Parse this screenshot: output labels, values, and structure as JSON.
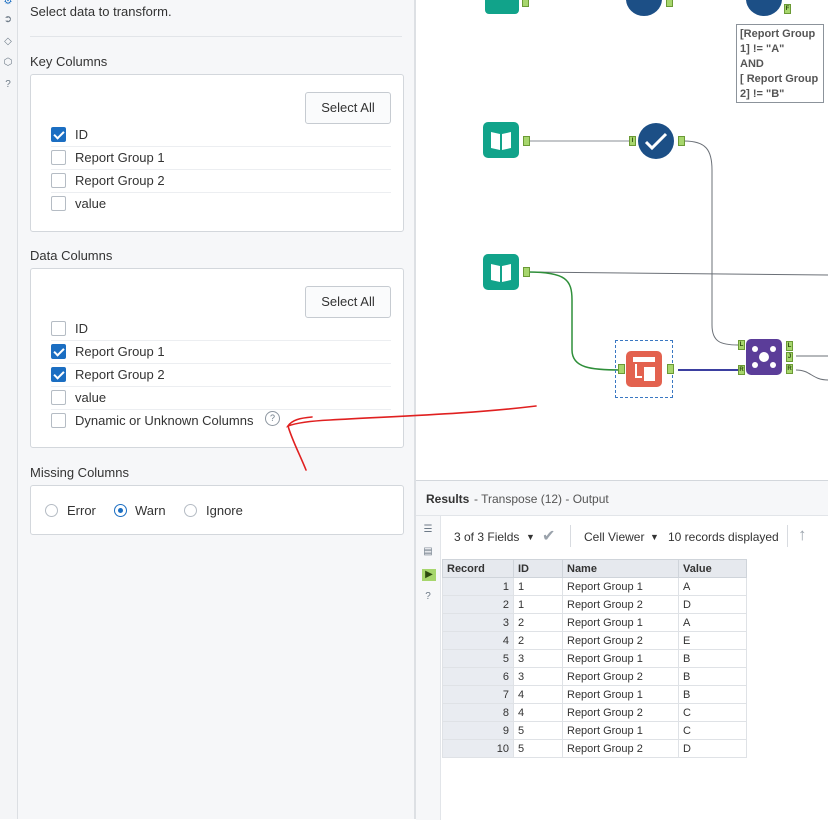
{
  "config": {
    "intro": "Select data to transform.",
    "key_columns": {
      "title": "Key Columns",
      "select_all": "Select All",
      "items": [
        {
          "label": "ID",
          "checked": true
        },
        {
          "label": "Report Group 1",
          "checked": false
        },
        {
          "label": "Report Group 2",
          "checked": false
        },
        {
          "label": "value",
          "checked": false
        }
      ]
    },
    "data_columns": {
      "title": "Data Columns",
      "select_all": "Select All",
      "items": [
        {
          "label": "ID",
          "checked": false
        },
        {
          "label": "Report Group 1",
          "checked": true
        },
        {
          "label": "Report Group 2",
          "checked": true
        },
        {
          "label": "value",
          "checked": false
        },
        {
          "label": "Dynamic or Unknown Columns",
          "checked": false
        }
      ]
    },
    "missing_columns": {
      "title": "Missing Columns",
      "options": [
        "Error",
        "Warn",
        "Ignore"
      ],
      "selected": "Warn"
    }
  },
  "canvas": {
    "filter_note": [
      "[Report Group",
      "1] != \"A\"",
      "AND",
      "[ Report Group",
      "2] != \"B\""
    ],
    "anchors": {
      "left": "L",
      "join": "J",
      "right": "R",
      "input": "I",
      "false": "F"
    }
  },
  "results": {
    "title": "Results",
    "subtitle": "- Transpose (12) - Output",
    "fields": "3 of 3 Fields",
    "viewer": "Cell Viewer",
    "records": "10 records displayed",
    "columns": [
      "Record",
      "ID",
      "Name",
      "Value"
    ],
    "rows": [
      [
        "1",
        "1",
        "Report Group 1",
        "A"
      ],
      [
        "2",
        "1",
        "Report Group 2",
        "D"
      ],
      [
        "3",
        "2",
        "Report Group 1",
        "A"
      ],
      [
        "4",
        "2",
        "Report Group 2",
        "E"
      ],
      [
        "5",
        "3",
        "Report Group 1",
        "B"
      ],
      [
        "6",
        "3",
        "Report Group 2",
        "B"
      ],
      [
        "7",
        "4",
        "Report Group 1",
        "B"
      ],
      [
        "8",
        "4",
        "Report Group 2",
        "C"
      ],
      [
        "9",
        "5",
        "Report Group 1",
        "C"
      ],
      [
        "10",
        "5",
        "Report Group 2",
        "D"
      ]
    ]
  },
  "colors": {
    "accent": "#1b6ec2",
    "input_tool": "#11a38a",
    "filter_tool": "#1c4f86",
    "transform_tool": "#e3624f",
    "join_tool": "#5b3d99",
    "anchor": "#a7d66d",
    "annotation": "#e02020"
  }
}
